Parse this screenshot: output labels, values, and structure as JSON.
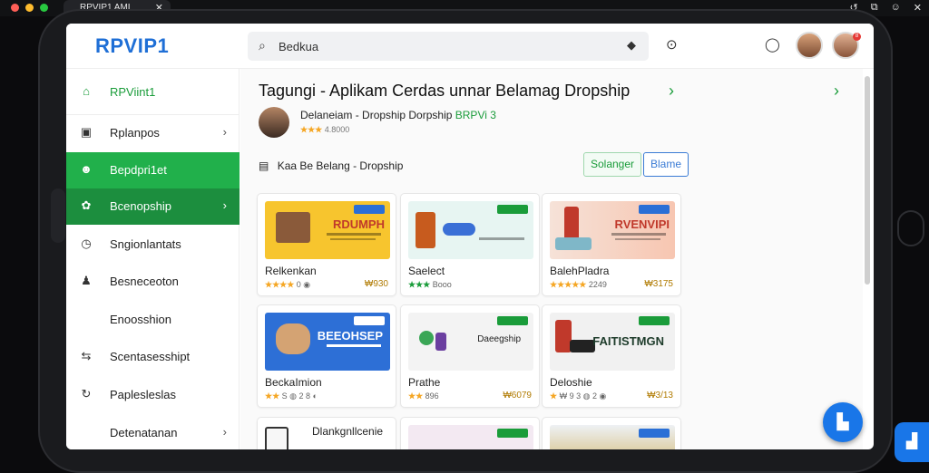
{
  "window": {
    "tab_title": "RPVIP1 AMI",
    "tab_close": "✕",
    "controls": [
      "↺",
      "⧉",
      "☺",
      "✕"
    ],
    "traffic_lights": [
      "#ff5f57",
      "#febc2e",
      "#28c840"
    ]
  },
  "header": {
    "logo": "RPVIP1",
    "search": {
      "value": "Bedkua",
      "icon": "search-icon"
    },
    "camera_icon": "◆",
    "header_icons": [
      "⊙",
      "◯"
    ],
    "notification_count": "8"
  },
  "sidebar": {
    "items": [
      {
        "label": "RPViint1",
        "icon": "home-icon",
        "glyph": "⌂",
        "chevron": ""
      },
      {
        "label": "Rplanpos",
        "icon": "wallet-icon",
        "glyph": "▣",
        "chevron": "›"
      },
      {
        "label": "Bepdpri1et",
        "icon": "profile-icon",
        "glyph": "☻",
        "chevron": ""
      },
      {
        "label": "Bcenopship",
        "icon": "gear-icon",
        "glyph": "✿",
        "chevron": "›"
      },
      {
        "label": "Sngionlantats",
        "icon": "clock-icon",
        "glyph": "◷",
        "chevron": ""
      },
      {
        "label": "Besneceoton",
        "icon": "users-icon",
        "glyph": "♟",
        "chevron": ""
      },
      {
        "label": "Enoosshion",
        "icon": "blank-icon",
        "glyph": "",
        "chevron": ""
      },
      {
        "label": "Scentasesshipt",
        "icon": "arrows-icon",
        "glyph": "⇆",
        "chevron": ""
      },
      {
        "label": "Paplesleslas",
        "icon": "refresh-icon",
        "glyph": "↻",
        "chevron": ""
      },
      {
        "label": "Detenatanan",
        "icon": "blank-icon",
        "glyph": "",
        "chevron": "›"
      }
    ]
  },
  "main": {
    "title": "Tagungi - Aplikam Cerdas unnar Belamag Dropship",
    "title_chevrons": [
      "›",
      "›"
    ],
    "seller": {
      "name": "Delaneiam - Dropship Dorpship",
      "brand": "BRPVi 3",
      "stars": "★★★",
      "rating": "4.8000"
    },
    "filter_label": "Kaa Be Belang - Dropship",
    "filter_icon": "▤",
    "buttons": {
      "primary": "Solanger",
      "secondary": "Blame"
    },
    "products": [
      {
        "name": "Relkenkan",
        "stars": "★★★★",
        "meta": "0 ◉",
        "price": "₩930",
        "banner": "RDUMPH",
        "bg": "#f7c52e",
        "tag": "blue"
      },
      {
        "name": "Saelect",
        "stars": "★★★",
        "meta": "Booo",
        "price": "",
        "banner": "",
        "bg": "#e7f5f2",
        "tag": "green"
      },
      {
        "name": "BalehPladra",
        "stars": "★★★★★",
        "meta": "2249",
        "price": "₩3175",
        "banner": "RVENVIPI",
        "bg": "#f8d7c8",
        "tag": "blue"
      },
      {
        "name": "BeckaImion",
        "stars": "★★",
        "meta": "S ◍ 2 8 ◐",
        "price": "",
        "banner": "BEEOHSEP",
        "bg": "#2d6fd6",
        "tag": "blue"
      },
      {
        "name": "Prathe",
        "stars": "★★",
        "meta": "896",
        "price": "₩6079",
        "banner": "Daeegship",
        "bg": "#f3f3f3",
        "tag": "green"
      },
      {
        "name": "Deloshie",
        "stars": "★",
        "meta": "₩ 9 3 ◍ 2 ◉",
        "price": "₩3/13",
        "banner": "FAITISTMGN",
        "bg": "#f1f1f1",
        "tag": "green"
      },
      {
        "name": "Dlankgnllcenie",
        "stars": "",
        "meta": "",
        "price": "",
        "banner": "",
        "bg": "#f7f7f7",
        "tag": "green"
      },
      {
        "name": "",
        "stars": "",
        "meta": "",
        "price": "",
        "banner": "",
        "bg": "#f3e9f2",
        "tag": "green"
      },
      {
        "name": "",
        "stars": "",
        "meta": "",
        "price": "",
        "banner": "",
        "bg": "#eef1f4",
        "tag": "blue"
      }
    ]
  },
  "fab": {
    "icon": "chart-icon",
    "glyph": "▙"
  },
  "fab2": {
    "icon": "chart-icon",
    "glyph": "▟"
  }
}
